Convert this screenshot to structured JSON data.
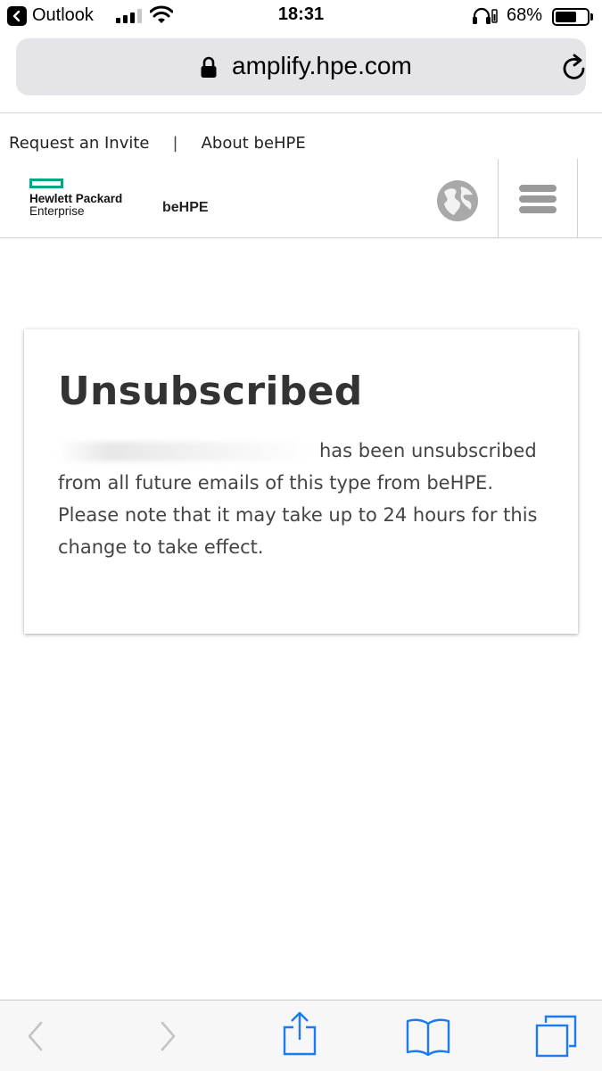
{
  "status_bar": {
    "back_app": "Outlook",
    "time": "18:31",
    "battery": "68%",
    "battery_level": 0.68
  },
  "browser": {
    "url": "amplify.hpe.com"
  },
  "site_header": {
    "links": [
      "Request an Invite",
      "About beHPE"
    ],
    "separator": "|",
    "logo_line1": "Hewlett Packard",
    "logo_line2": "Enterprise",
    "brand": "beHPE"
  },
  "card": {
    "title": "Unsubscribed",
    "message": "has been unsubscribed from all future emails of this type from beHPE. Please note that it may take up to 24 hours for this change to take effect."
  },
  "colors": {
    "hpe_green": "#01a982",
    "ios_blue": "#1a7cf5",
    "disabled_gray": "#c4c4c8"
  }
}
